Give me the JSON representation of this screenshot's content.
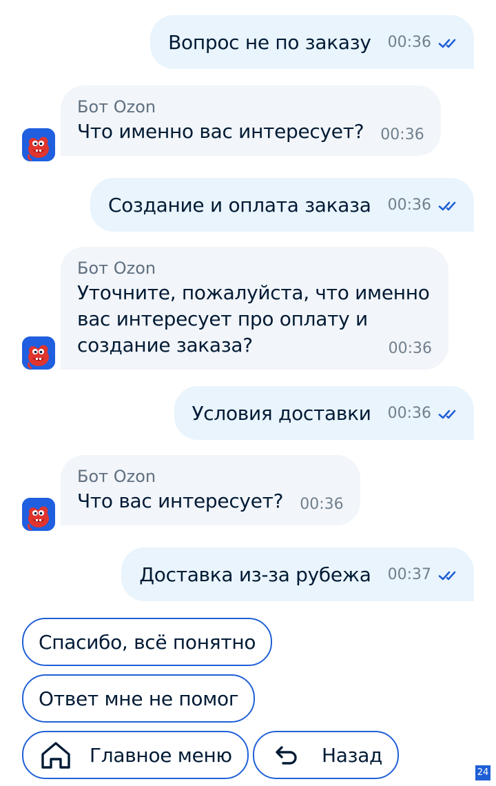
{
  "chat": {
    "bot_name": "Бот Ozon",
    "messages": [
      {
        "from": "user",
        "text": "Вопрос не по заказу",
        "time": "00:36",
        "status": "read"
      },
      {
        "from": "bot",
        "text": "Что именно вас интересует?",
        "time": "00:36"
      },
      {
        "from": "user",
        "text": "Создание и оплата заказа",
        "time": "00:36",
        "status": "read"
      },
      {
        "from": "bot",
        "lines": [
          "Уточните, пожалуйста, что именно",
          "вас интересует про оплату и",
          "создание заказа?"
        ],
        "time": "00:36"
      },
      {
        "from": "user",
        "text": "Условия доставки",
        "time": "00:36",
        "status": "read"
      },
      {
        "from": "bot",
        "text": "Что вас интересует?",
        "time": "00:36"
      },
      {
        "from": "user",
        "text": "Доставка из-за рубежа",
        "time": "00:37",
        "status": "read"
      }
    ]
  },
  "quick_replies": {
    "thanks": "Спасибо, всё понятно",
    "not_helped": "Ответ мне не помог",
    "main_menu": "Главное меню",
    "back": "Назад"
  },
  "colors": {
    "accent": "#1f5fd6",
    "outgoing_bubble": "#e9f4fc",
    "incoming_bubble": "#f2f5f9",
    "text": "#001a34",
    "muted": "#707f8d"
  },
  "icons": {
    "read_receipt": "double-check-icon",
    "bot_avatar": "bot-avatar-icon",
    "main_menu": "home-icon",
    "back": "back-arrow-icon"
  },
  "corner_badge": "24"
}
